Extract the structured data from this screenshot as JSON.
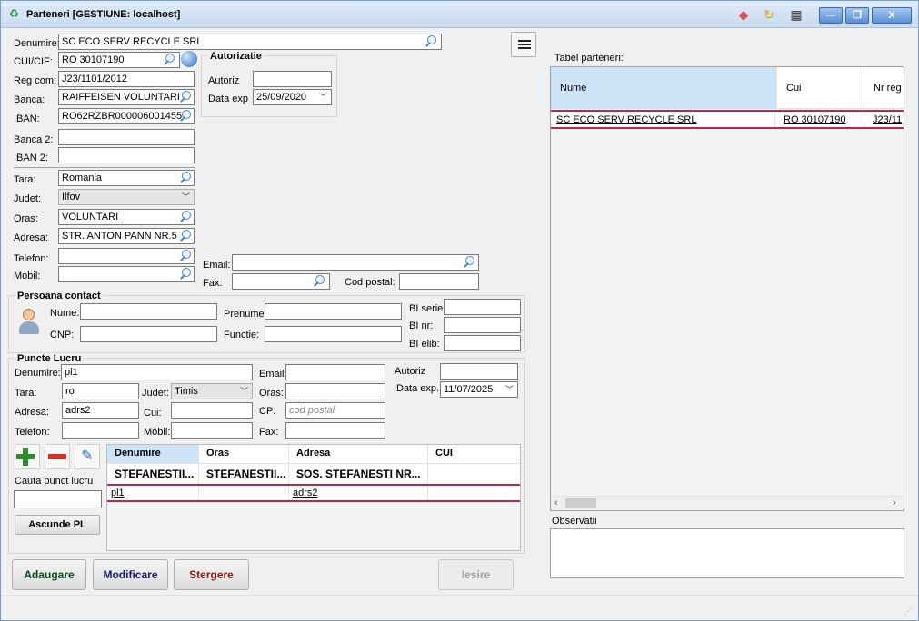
{
  "window": {
    "title": "Parteneri [GESTIUNE: localhost]"
  },
  "partner": {
    "denumire_label": "Denumire:",
    "denumire": "SC  ECO SERV RECYCLE SRL",
    "cui_label": "CUI/CIF:",
    "cui": "RO 30107190",
    "regcom_label": "Reg com:",
    "regcom": "J23/1101/2012",
    "banca_label": "Banca:",
    "banca": "RAIFFEISEN VOLUNTARI",
    "iban_label": "IBAN:",
    "iban": "RO62RZBR000006001455",
    "banca2_label": "Banca 2:",
    "banca2": "",
    "iban2_label": "IBAN 2:",
    "iban2": "",
    "tara_label": "Tara:",
    "tara": "Romania",
    "judet_label": "Judet:",
    "judet": "Ilfov",
    "oras_label": "Oras:",
    "oras": "VOLUNTARI",
    "adresa_label": "Adresa:",
    "adresa": "STR. ANTON PANN NR.5",
    "telefon_label": "Telefon:",
    "telefon": "",
    "mobil_label": "Mobil:",
    "mobil": "",
    "email_label": "Email:",
    "email": "",
    "fax_label": "Fax:",
    "fax": "",
    "codpostal_label": "Cod postal:",
    "codpostal": ""
  },
  "autorizatie": {
    "title": "Autorizatie",
    "autoriz_label": "Autoriz",
    "autoriz": "",
    "dataexp_label": "Data exp",
    "dataexp": "25/09/2020"
  },
  "contact": {
    "title": "Persoana contact",
    "nume_label": "Nume:",
    "nume": "",
    "prenume_label": "Prenume:",
    "prenume": "",
    "cnp_label": "CNP:",
    "cnp": "",
    "functie_label": "Functie:",
    "functie": "",
    "biserie_label": "BI serie:",
    "biserie": "",
    "binr_label": "BI nr:",
    "binr": "",
    "bielib_label": "BI elib:",
    "bielib": ""
  },
  "puncte": {
    "title": "Puncte Lucru",
    "denumire_label": "Denumire:",
    "denumire": "pl1",
    "tara_label": "Tara:",
    "tara": "ro",
    "judet_label": "Judet:",
    "judet": "Timis",
    "adresa_label": "Adresa:",
    "adresa": "adrs2",
    "cui_label": "Cui:",
    "cui": "",
    "telefon_label": "Telefon:",
    "telefon": "",
    "mobil_label": "Mobil:",
    "mobil": "",
    "email_label": "Email:",
    "email": "",
    "oras_label": "Oras:",
    "oras": "",
    "cp_label": "CP:",
    "cp_placeholder": "cod postal",
    "fax_label": "Fax:",
    "fax": "",
    "autoriz_label": "Autoriz",
    "autoriz": "",
    "dataexp_label": "Data exp.",
    "dataexp": "11/07/2025",
    "cauta_label": "Cauta punct lucru",
    "cauta": "",
    "ascunde_label": "Ascunde PL",
    "table": {
      "columns": [
        "Denumire",
        "Oras",
        "Adresa",
        "CUI"
      ],
      "filter_row": [
        "STEFANESTII...",
        "STEFANESTII...",
        "SOS. STEFANESTI NR...",
        ""
      ],
      "rows": [
        [
          "pl1",
          "",
          "adrs2",
          ""
        ]
      ]
    }
  },
  "tabel": {
    "label": "Tabel parteneri:",
    "columns": [
      "Nume",
      "Cui",
      "Nr reg"
    ],
    "rows": [
      [
        "SC  ECO SERV RECYCLE SRL",
        "RO 30107190",
        "J23/11"
      ]
    ]
  },
  "observatii": {
    "label": "Observatii",
    "value": ""
  },
  "buttons": {
    "adaugare": "Adaugare",
    "modificare": "Modificare",
    "stergere": "Stergere",
    "iesire": "Iesire"
  }
}
